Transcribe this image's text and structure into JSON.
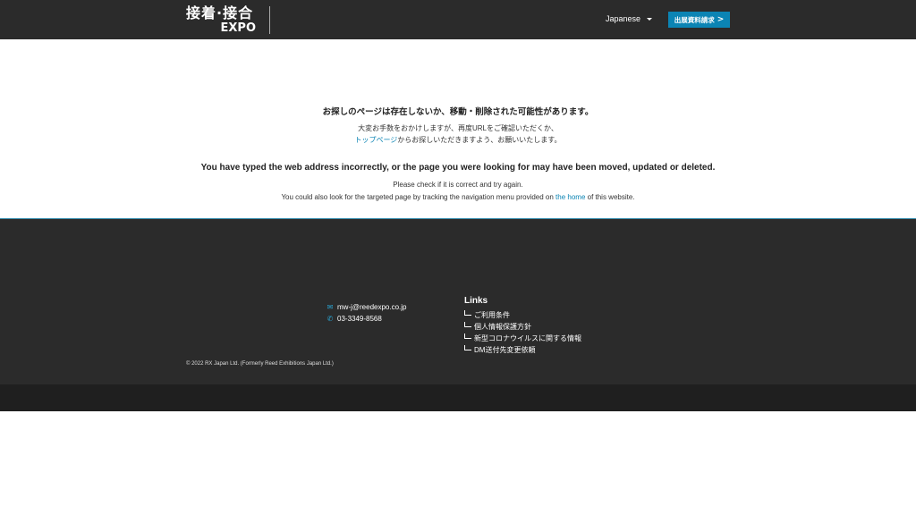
{
  "header": {
    "logo_line1": "接着·接合",
    "logo_line2": "EXPO",
    "language_label": "Japanese",
    "cta_label": "出展資料請求",
    "cta_arrow": ">"
  },
  "main": {
    "ja_title": "お探しのページは存在しないか、移動・削除された可能性があります。",
    "ja_line1": "大変お手数をおかけしますが、再度URLをご確認いただくか、",
    "ja_line2_link": "トップページ",
    "ja_line2_rest": "からお探しいただきますよう、お願いいたします。",
    "en_title": "You have typed the web address incorrectly, or the page you were looking for may have been moved, updated or deleted.",
    "en_line1": "Please check if it is correct and try again.",
    "en_line2_pre": "You could also look for the targeted page by tracking the navigation menu provided on ",
    "en_line2_link": "the home",
    "en_line2_post": " of this website."
  },
  "footer": {
    "email": "mw-j@reedexpo.co.jp",
    "phone": "03-3349-8568",
    "links_heading": "Links",
    "links": [
      "ご利用条件",
      "個人情報保護方針",
      "新型コロナウイルスに関する情報",
      "DM送付先変更依頼"
    ],
    "copyright": "© 2022 RX Japan Ltd. (Formerly Reed Exhibitions Japan Ltd.)"
  },
  "colors": {
    "header_bg": "#2b2b2b",
    "accent": "#0b84b4",
    "footer_bg": "#2b2b2b",
    "subfooter_bg": "#1f1f1f"
  }
}
